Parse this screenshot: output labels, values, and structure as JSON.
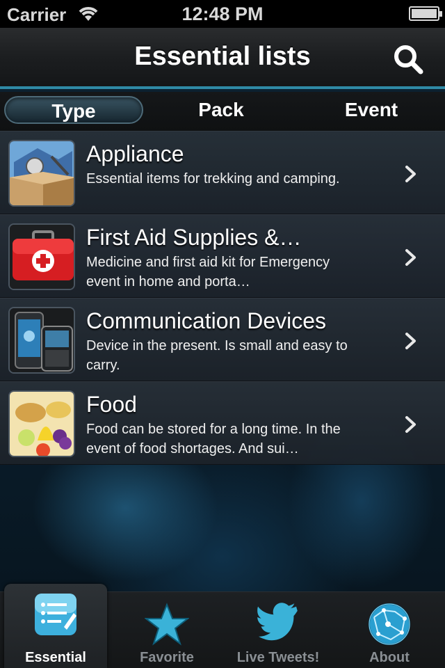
{
  "status_bar": {
    "carrier": "Carrier",
    "time": "12:48 PM",
    "wifi_icon": "wifi-icon",
    "battery_icon": "battery-icon"
  },
  "nav": {
    "title": "Essential lists",
    "search_icon": "search-icon"
  },
  "segments": {
    "type": "Type",
    "pack": "Pack",
    "event": "Event",
    "selected": "Type"
  },
  "list": {
    "items": [
      {
        "title": "Appliance",
        "description": "Essential items for trekking and camping.",
        "icon": "appliance-icon"
      },
      {
        "title": "First Aid Supplies &…",
        "description": "Medicine and first aid kit for Emergency event in home and porta…",
        "icon": "first-aid-kit-icon"
      },
      {
        "title": "Communication Devices",
        "description": "Device in the present. Is small and easy to carry.",
        "icon": "phones-icon"
      },
      {
        "title": "Food",
        "description": "Food can be stored for a long time. In the event of food shortages. And sui…",
        "icon": "food-icon"
      }
    ]
  },
  "tabs": {
    "essential": "Essential",
    "favorite": "Favorite",
    "live_tweets": "Live Tweets!",
    "about": "About",
    "selected": "Essential"
  },
  "colors": {
    "accent": "#2f8aa6",
    "tab_inactive": "#8a8f94",
    "tab_active": "#ffffff"
  }
}
